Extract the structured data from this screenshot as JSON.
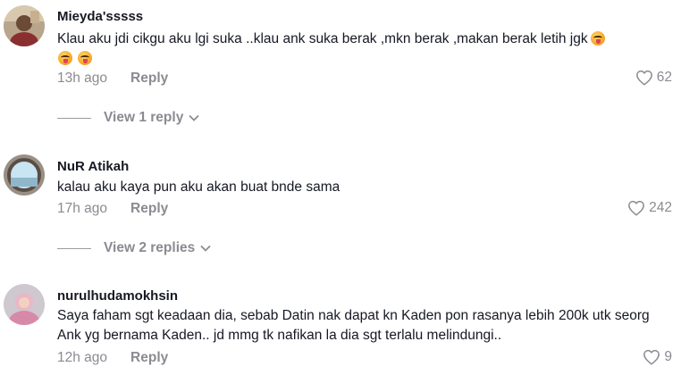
{
  "comments": [
    {
      "username": "Mieyda'sssss",
      "text": "Klau aku jdi cikgu aku lgi suka ..klau ank suka berak ,mkn berak ,makan berak letih jgk",
      "time": "13h ago",
      "reply_label": "Reply",
      "likes": "62",
      "view_replies": "View 1 reply",
      "avatar_icon": "user-avatar",
      "emoji_icon": "squinting-tongue-emoji"
    },
    {
      "username": "NuR Atikah",
      "text": "kalau aku kaya pun aku akan buat bnde sama",
      "time": "17h ago",
      "reply_label": "Reply",
      "likes": "242",
      "view_replies": "View 2 replies",
      "avatar_icon": "user-avatar"
    },
    {
      "username": "nurulhudamokhsin",
      "text": "Saya faham sgt keadaan dia, sebab Datin nak dapat kn Kaden pon rasanya lebih 200k utk seorg Ank yg bernama Kaden.. jd mmg tk nafikan la dia sgt terlalu melindungi..",
      "time": "12h ago",
      "reply_label": "Reply",
      "likes": "9",
      "avatar_icon": "user-avatar"
    }
  ],
  "colors": {
    "text_primary": "#161823",
    "text_secondary": "#8a8b91",
    "background": "#ffffff"
  },
  "icons": {
    "like": "heart-outline-icon",
    "expand": "chevron-down-icon"
  }
}
